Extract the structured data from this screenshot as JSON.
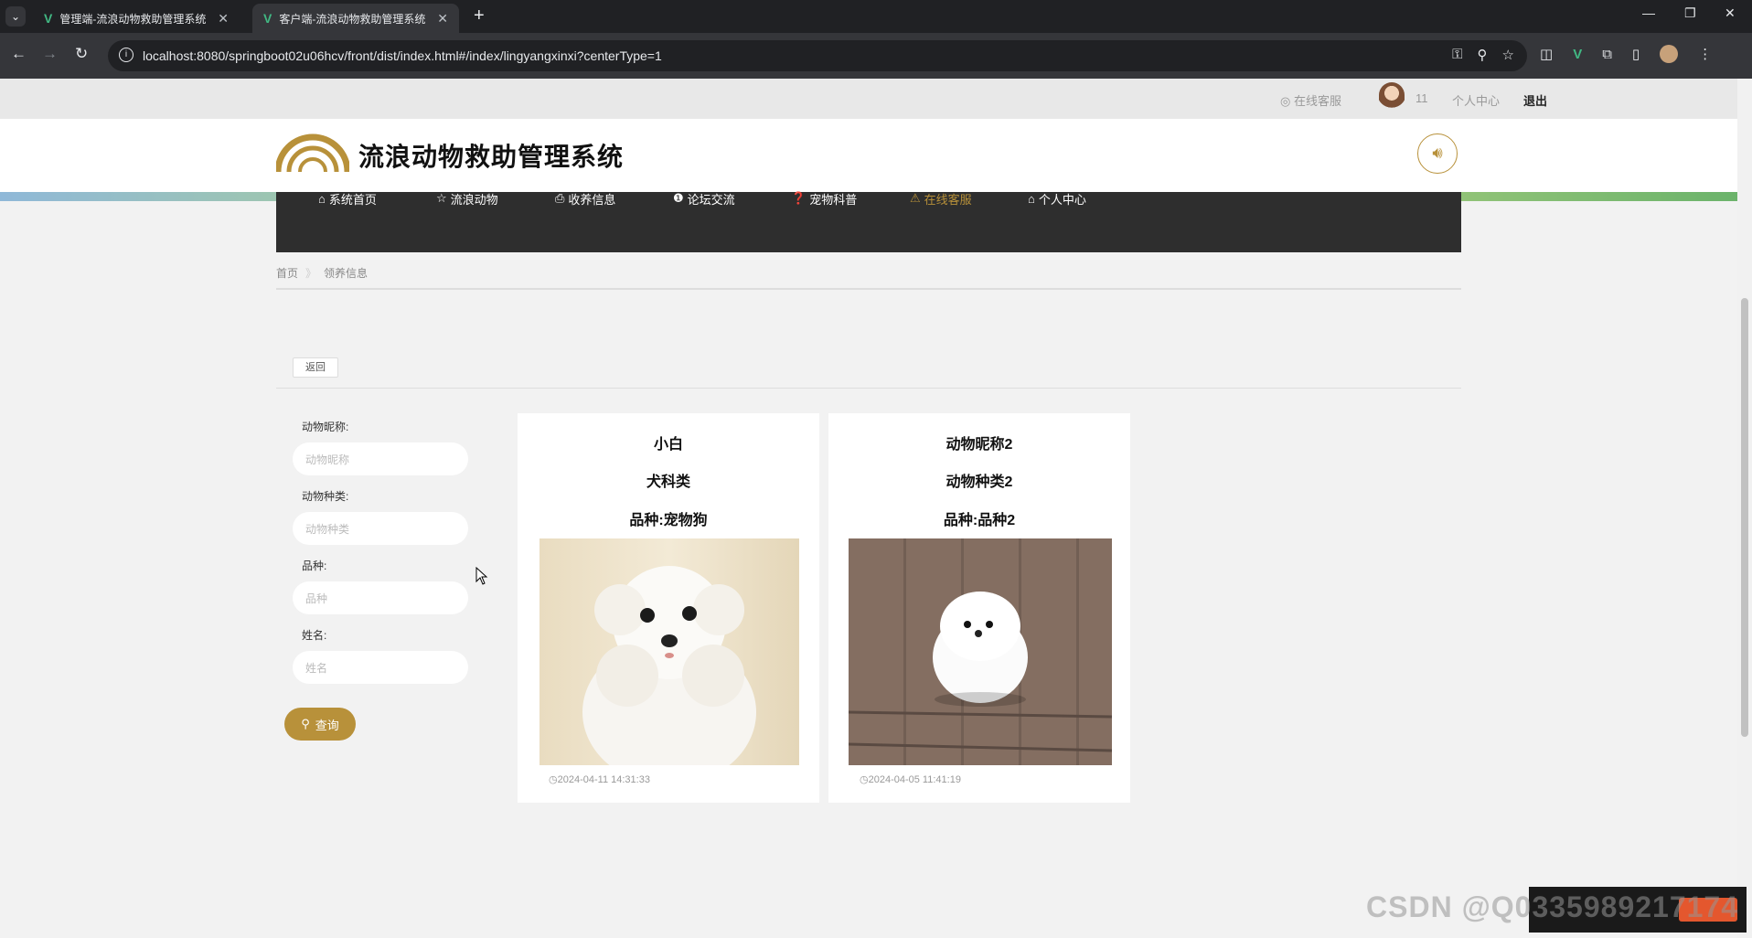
{
  "browser": {
    "tabs": [
      {
        "label": "管理端-流浪动物救助管理系统",
        "active": false
      },
      {
        "label": "客户端-流浪动物救助管理系统",
        "active": true
      }
    ],
    "url": "localhost:8080/springboot02u06hcv/front/dist/index.html#/index/lingyangxinxi?centerType=1"
  },
  "topbar": {
    "service": "在线客服",
    "username": "11",
    "center": "个人中心",
    "logout": "退出"
  },
  "header": {
    "site_title": "流浪动物救助管理系统"
  },
  "nav": [
    {
      "label": "系统首页",
      "icon": "⌂"
    },
    {
      "label": "流浪动物",
      "icon": "☆"
    },
    {
      "label": "收养信息",
      "icon": "⎙"
    },
    {
      "label": "论坛交流",
      "icon": "❶"
    },
    {
      "label": "宠物科普",
      "icon": "❓"
    },
    {
      "label": "在线客服",
      "icon": "⚠"
    },
    {
      "label": "个人中心",
      "icon": "⌂"
    }
  ],
  "breadcrumb": {
    "home": "首页",
    "separator": "》",
    "current": "领养信息"
  },
  "back_button": "返回",
  "filter": {
    "fields": [
      {
        "label": "动物昵称:",
        "placeholder": "动物昵称"
      },
      {
        "label": "动物种类:",
        "placeholder": "动物种类"
      },
      {
        "label": "品种:",
        "placeholder": "品种"
      },
      {
        "label": "姓名:",
        "placeholder": "姓名"
      }
    ],
    "search_label": "查询"
  },
  "cards": [
    {
      "name": "小白",
      "type": "犬科类",
      "breed": "品种:宠物狗",
      "time": "2024-04-11 14:31:33"
    },
    {
      "name": "动物昵称2",
      "type": "动物种类2",
      "breed": "品种:品种2",
      "time": "2024-04-05 11:41:19"
    }
  ],
  "watermark": "CSDN @Q0335989217174",
  "colors": {
    "accent": "#b8913a",
    "nav_bg": "#2e2e2e",
    "page_bg": "#f2f2f2"
  }
}
